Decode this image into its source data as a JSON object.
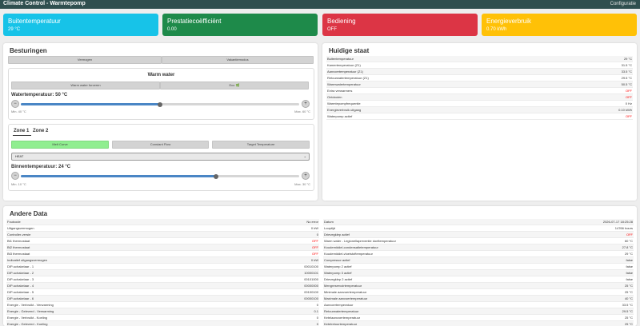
{
  "header": {
    "title": "Climate Control - Warmtepomp",
    "config_link": "Configuratie"
  },
  "cards": [
    {
      "title": "Buitentemperatuur",
      "value": "29 °C",
      "color": "#17c3e8"
    },
    {
      "title": "Prestatiecoëfficiënt",
      "value": "0.00",
      "color": "#1e8a4a"
    },
    {
      "title": "Bediening",
      "value": "OFF",
      "color": "#dc3545"
    },
    {
      "title": "Energieverbruik",
      "value": "0.70 kWh",
      "color": "#ffc107"
    }
  ],
  "controls": {
    "title": "Besturingen",
    "power_button": "Vermogen",
    "vacation_button": "Vakantiemodus",
    "warm_water": {
      "title": "Warm water",
      "force_button": "Warm water forceren",
      "eco_button": "Eco 🌿",
      "slider_label": "Watertemperatuur: 50 °C",
      "min_label": "Min. 40 °C",
      "max_label": "Max. 60 °C",
      "minus": "−",
      "plus": "+",
      "fraction": 0.5
    },
    "zones": {
      "tab1": "Zone 1",
      "tab2": "Zone 2",
      "mode_buttons": [
        "Melt Curve",
        "Constant Flow",
        "Target Temperature"
      ],
      "mode_select": "HEAT",
      "slider_label": "Binnentemperatuur: 24 °C",
      "min_label": "Min. 10 °C",
      "max_label": "Max. 30 °C",
      "minus": "−",
      "plus": "+",
      "fraction": 0.7
    }
  },
  "state": {
    "title": "Huidige staat",
    "rows": [
      {
        "label": "Buitentemperatuur",
        "value": "29 °C",
        "off": false
      },
      {
        "label": "Kamertemperatuur (Z1)",
        "value": "31.5 °C",
        "off": false
      },
      {
        "label": "Aanvoertemperatuur (Z1)",
        "value": "33.5 °C",
        "off": false
      },
      {
        "label": "Retourwatertemperatuur (Z1)",
        "value": "29.5 °C",
        "off": false
      },
      {
        "label": "Warmwatertemperatuur",
        "value": "50.5 °C",
        "off": false
      },
      {
        "label": "Extra verwarmers",
        "value": "OFF",
        "off": true
      },
      {
        "label": "Ontdooien",
        "value": "OFF",
        "off": true
      },
      {
        "label": "Warmtepompfrequentie",
        "value": "0 Hz",
        "off": false
      },
      {
        "label": "Energieverbruik uitgang",
        "value": "0.10 kWh",
        "off": false
      },
      {
        "label": "Waterpomp actief",
        "value": "OFF",
        "off": true
      }
    ]
  },
  "other": {
    "title": "Andere Data",
    "left": [
      {
        "label": "Foutcode",
        "value": "No error",
        "off": false
      },
      {
        "label": "Uitgangsvermogen",
        "value": "0 kW",
        "off": false
      },
      {
        "label": "Controller-versie",
        "value": "0",
        "off": false
      },
      {
        "label": "Bt1 thermostaat",
        "value": "OFF",
        "off": true
      },
      {
        "label": "Bt2 thermostaat",
        "value": "OFF",
        "off": true
      },
      {
        "label": "Bt3 thermostaat",
        "value": "OFF",
        "off": true
      },
      {
        "label": "Indicatief uitgangsvermogen",
        "value": "0 kW",
        "off": false
      },
      {
        "label": "DIP-schakelaar - 1",
        "value": "00010100",
        "off": false
      },
      {
        "label": "DIP-schakelaar - 2",
        "value": "10000101",
        "off": false
      },
      {
        "label": "DIP-schakelaar - 3",
        "value": "00101000",
        "off": false
      },
      {
        "label": "DIP-schakelaar - 4",
        "value": "00000000",
        "off": false
      },
      {
        "label": "DIP-schakelaar - 5",
        "value": "00100100",
        "off": false
      },
      {
        "label": "DIP-schakelaar - 6",
        "value": "00000100",
        "off": false
      },
      {
        "label": "Energie - Verbruikt - Verwarming",
        "value": "0",
        "off": false
      },
      {
        "label": "Energie - Geleverd - Verwarming",
        "value": "0.1",
        "off": false
      },
      {
        "label": "Energie - Verbruikt - Koeling",
        "value": "0",
        "off": false
      },
      {
        "label": "Energie - Geleverd - Koeling",
        "value": "0",
        "off": false
      }
    ],
    "right": [
      {
        "label": "Datum",
        "value": "2026-07-17 18:25:28",
        "off": false
      },
      {
        "label": "Looptijd",
        "value": "14766 hours",
        "off": false
      },
      {
        "label": "Drievegklep actief",
        "value": "OFF",
        "off": true
      },
      {
        "label": "Warm water - Legionellapreventie doeltemperatuur",
        "value": "60 °C",
        "off": false
      },
      {
        "label": "Koudemiddel-condensatietemperatuur",
        "value": "27.8 °C",
        "off": false
      },
      {
        "label": "Koudemiddel-vloeistoftemperatuur",
        "value": "29 °C",
        "off": false
      },
      {
        "label": "Compressor actief",
        "value": "false",
        "off": false
      },
      {
        "label": "Waterpomp 2 actief",
        "value": "false",
        "off": false
      },
      {
        "label": "Waterpomp 3 actief",
        "value": "false",
        "off": false
      },
      {
        "label": "Drievegklep 2 actief",
        "value": "false",
        "off": false
      },
      {
        "label": "Mengreservoirtemperatuur",
        "value": "25 °C",
        "off": false
      },
      {
        "label": "Minimale aanvoertemperatuur",
        "value": "25 °C",
        "off": false
      },
      {
        "label": "Maximale aanvoertemperatuur",
        "value": "40 °C",
        "off": false
      },
      {
        "label": "Aanvoertemperatuur",
        "value": "33.5 °C",
        "off": false
      },
      {
        "label": "Retourwatertemperatuur",
        "value": "29.5 °C",
        "off": false
      },
      {
        "label": "Ketelaanvoertemperatuur",
        "value": "25 °C",
        "off": false
      },
      {
        "label": "Ketelretourtemperatuur",
        "value": "25 °C",
        "off": false
      }
    ]
  }
}
